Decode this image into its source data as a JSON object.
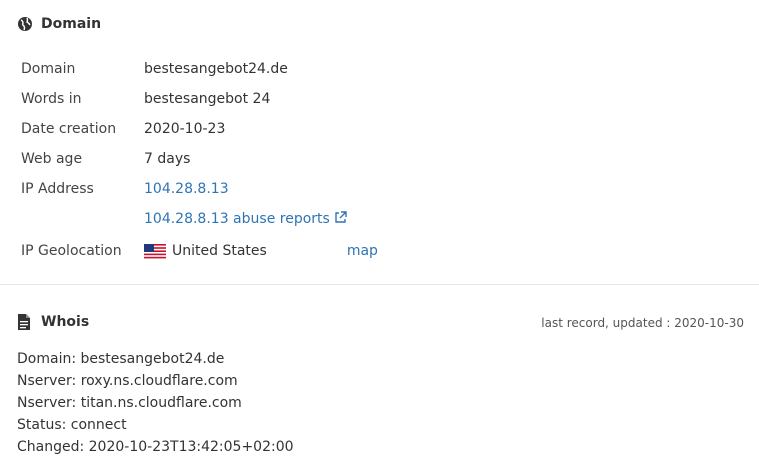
{
  "domain_section": {
    "title": "Domain",
    "icon": "globe-icon",
    "rows": [
      {
        "label": "Domain",
        "value": "bestesangebot24.de"
      },
      {
        "label": "Words in",
        "value": "bestesangebot 24"
      },
      {
        "label": "Date creation",
        "value": "2020-10-23"
      },
      {
        "label": "Web age",
        "value": "7 days"
      },
      {
        "label": "IP Address",
        "value": "104.28.8.13"
      }
    ],
    "abuse_link": "104.28.8.13 abuse reports",
    "geolocation": {
      "label": "IP Geolocation",
      "country": "United States",
      "flag": "us-flag-icon",
      "map_link": "map"
    }
  },
  "whois_section": {
    "title": "Whois",
    "icon": "document-icon",
    "meta": "last record, updated : 2020-10-30",
    "lines": [
      "Domain: bestesangebot24.de",
      "Nserver: roxy.ns.cloudflare.com",
      "Nserver: titan.ns.cloudflare.com",
      "Status: connect",
      "Changed: 2020-10-23T13:42:05+02:00"
    ]
  },
  "colors": {
    "link": "#2f74b5",
    "text": "#333333",
    "divider": "#e7e7e7"
  }
}
